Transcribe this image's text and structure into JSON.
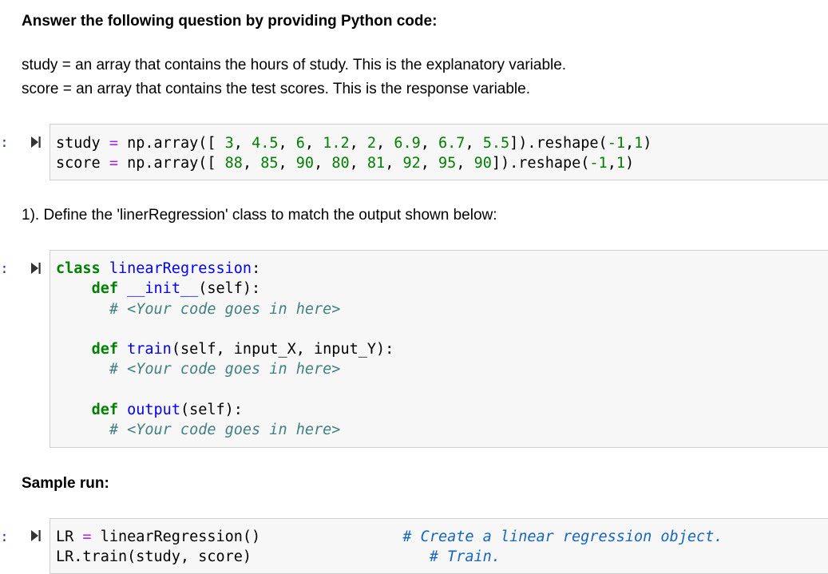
{
  "header": {
    "question_title": "Answer the following question by providing Python code:",
    "study_desc": "study = an array that contains the hours of study. This is the explanatory variable.",
    "score_desc": "score = an array that contains the test scores. This is the response variable."
  },
  "cell1": {
    "prompt": ":",
    "line1": {
      "var": "study",
      "eq": "=",
      "call": "np.array([",
      "nums": [
        "3",
        "4.5",
        "6",
        "1.2",
        "2",
        "6.9",
        "6.7",
        "5.5"
      ],
      "tail": "]).reshape(",
      "arg1": "-1",
      "arg2": "1",
      "end": ")"
    },
    "line2": {
      "var": "score",
      "eq": "=",
      "call": "np.array([",
      "nums": [
        "88",
        "85",
        "90",
        "80",
        "81",
        "92",
        "95",
        "90"
      ],
      "tail": "]).reshape(",
      "arg1": "-1",
      "arg2": "1",
      "end": ")"
    }
  },
  "task1": "1). Define the 'linerRegression' class to match the output shown below:",
  "cell2": {
    "prompt": ":",
    "class_kw": "class",
    "class_name": "linearRegression",
    "def_kw": "def",
    "init_name": "__init__",
    "init_args": "(self):",
    "placeholder": "# <Your code goes in here>",
    "train_name": "train",
    "train_args": "(self, input_X, input_Y):",
    "output_name": "output",
    "output_args": "(self):"
  },
  "sample_run": "Sample run:",
  "cell3": {
    "prompt": ":",
    "line1_a": "LR",
    "line1_eq": "=",
    "line1_b": "linearRegression()",
    "line1_comment": "# Create a linear regression object.",
    "line2": "LR.train(study, score)",
    "line2_comment": "# Train."
  },
  "colors": {
    "keyword": "#008000",
    "function": "#0000ff",
    "operator": "#aa22ff",
    "comment": "#408080",
    "cell_bg": "#f7f7f7",
    "cell_border": "#cfcfcf",
    "prompt": "#303f9f"
  },
  "icons": [
    "run-cell-icon"
  ]
}
